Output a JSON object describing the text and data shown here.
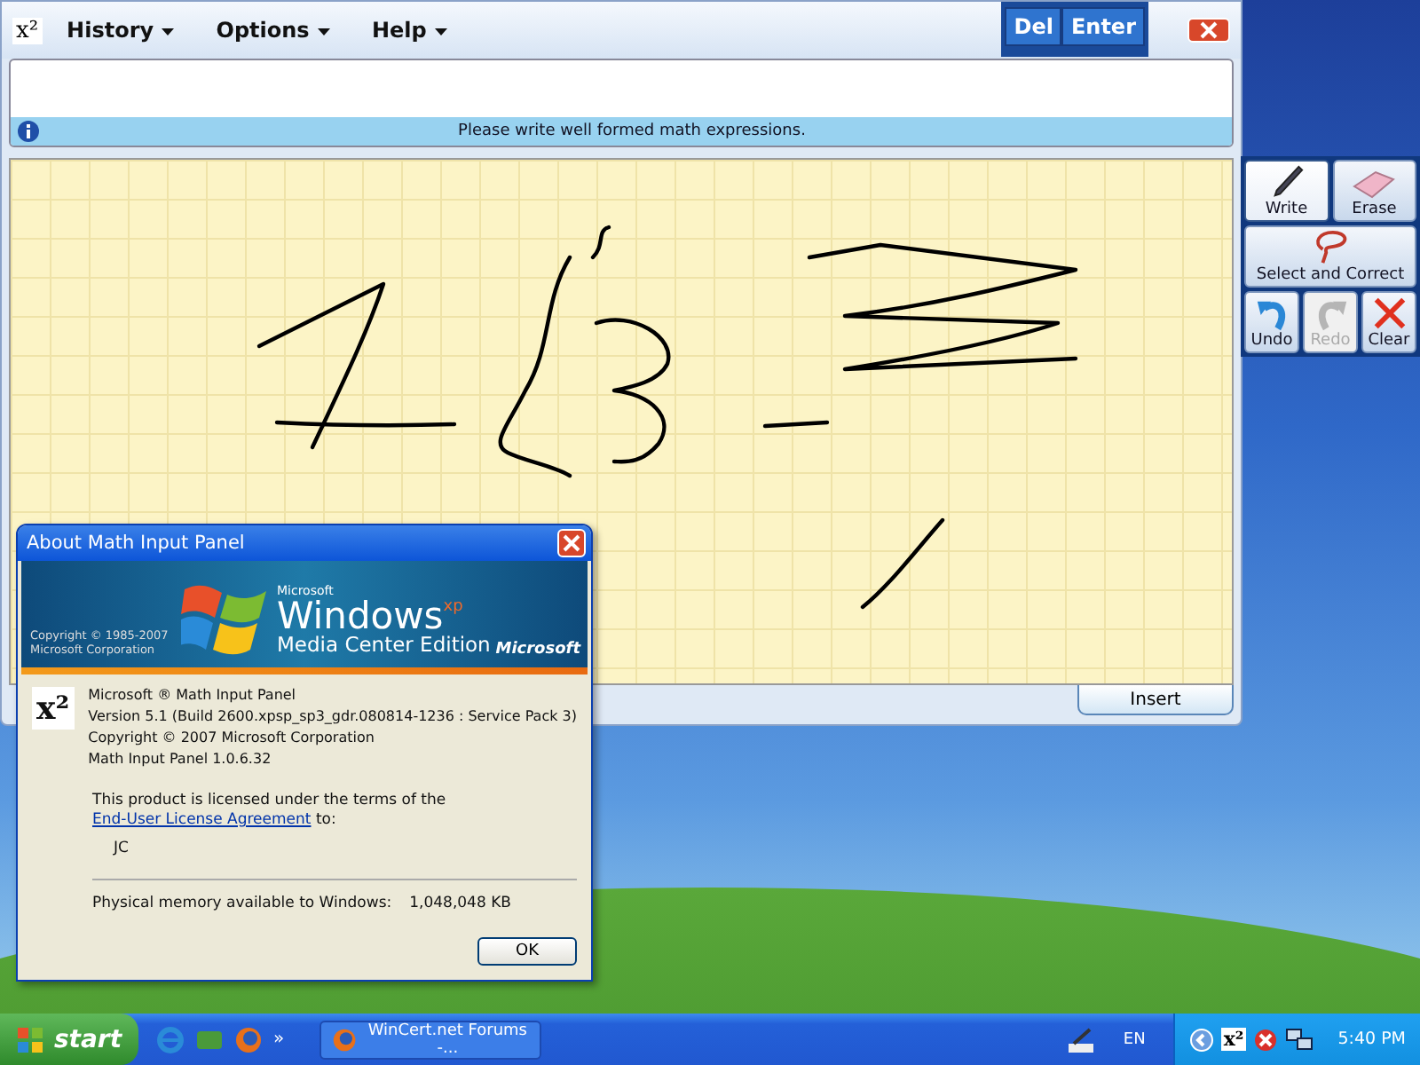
{
  "window": {
    "app_icon": "x²",
    "menus": [
      {
        "label": "History"
      },
      {
        "label": "Options"
      },
      {
        "label": "Help"
      }
    ],
    "buttons": [
      "Del",
      "Enter"
    ]
  },
  "output": {
    "message": "Please write well formed math expressions."
  },
  "tools": [
    {
      "kind": "write",
      "label": "Write",
      "selected": true,
      "disabled": false
    },
    {
      "kind": "erase",
      "label": "Erase",
      "selected": false,
      "disabled": false
    },
    {
      "kind": "select",
      "label": "Select and Correct",
      "selected": false,
      "disabled": false
    },
    {
      "kind": "undo",
      "label": "Undo",
      "selected": false,
      "disabled": false
    },
    {
      "kind": "redo",
      "label": "Redo",
      "selected": false,
      "disabled": true
    },
    {
      "kind": "clear",
      "label": "Clear",
      "selected": false,
      "disabled": false
    }
  ],
  "insert_button": "Insert",
  "dialog": {
    "title": "About Math Input Panel",
    "banner": {
      "maker": "Microsoft",
      "product": "Windows",
      "edition_mark": "xp",
      "edition": "Media Center Edition",
      "copyright": "Copyright © 1985-2007",
      "company": "Microsoft Corporation",
      "brand": "Microsoft"
    },
    "app_icon": "x²",
    "lines": [
      "Microsoft ® Math Input Panel",
      "Version 5.1 (Build 2600.xpsp_sp3_gdr.080814-1236 : Service Pack 3)",
      "Copyright © 2007 Microsoft Corporation",
      "Math Input Panel 1.0.6.32"
    ],
    "license_text": "This product is licensed under the terms of the",
    "license_link": "End-User License Agreement",
    "license_after": "to:",
    "user": "JC",
    "memory_label": "Physical memory available to Windows:",
    "memory_value": "1,048,048 KB",
    "ok": "OK"
  },
  "taskbar": {
    "start": "start",
    "more": "»",
    "task": "WinCert.net Forums -...",
    "language": "EN",
    "tray_app": "x²",
    "time": "5:40 PM"
  }
}
